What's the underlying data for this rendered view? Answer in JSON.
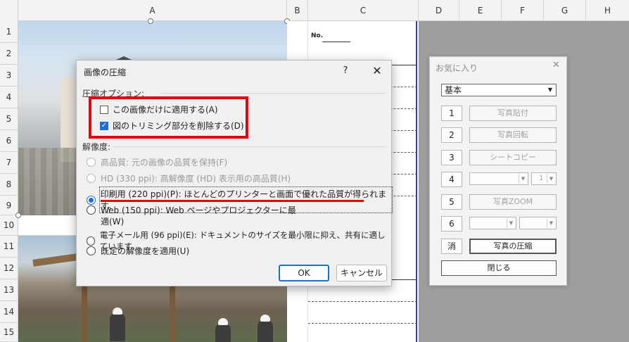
{
  "sheet": {
    "columns": [
      "A",
      "B",
      "C",
      "D",
      "E",
      "F",
      "G",
      "H"
    ],
    "rows": [
      "1",
      "2",
      "3",
      "4",
      "5",
      "6",
      "7",
      "8",
      "9",
      "10",
      "11",
      "12",
      "13",
      "14",
      "15"
    ],
    "form_no_label": "No."
  },
  "dialog": {
    "title": "画像の圧縮",
    "help": "?",
    "close": "✕",
    "compression_group": "圧縮オプション:",
    "apply_only_this": {
      "label": "この画像だけに適用する(A)",
      "checked": false
    },
    "delete_cropped": {
      "label": "図のトリミング部分を削除する(D)",
      "checked": true
    },
    "resolution_group": "解像度:",
    "options": [
      {
        "label": "高品質: 元の画像の品質を保持(F)",
        "enabled": false,
        "selected": false
      },
      {
        "label": "HD (330 ppi): 高解像度 (HD) 表示用の高品質(H)",
        "enabled": false,
        "selected": false
      },
      {
        "label": "印刷用 (220 ppi)(P): ほとんどのプリンターと画面で優れた品質が得られます。",
        "enabled": true,
        "selected": true
      },
      {
        "label": "Web (150 ppi): Web ページやプロジェクターに最",
        "label_cont": "適(W)",
        "enabled": true,
        "selected": false
      },
      {
        "label": "電子メール用 (96 ppi)(E): ドキュメントのサイズを最小限に抑え、共有に適しています。",
        "enabled": true,
        "selected": false
      },
      {
        "label": "既定の解像度を適用(U)",
        "enabled": true,
        "selected": false
      }
    ],
    "ok": "OK",
    "cancel": "キャンセル"
  },
  "favorites": {
    "title": "お気に入り",
    "close": "✕",
    "preset": "基本",
    "rows": [
      {
        "num": "1",
        "label": "写真貼付"
      },
      {
        "num": "2",
        "label": "写真回転"
      },
      {
        "num": "3",
        "label": "シートコピー"
      },
      {
        "num": "4",
        "label": "",
        "combo_value": "1"
      },
      {
        "num": "5",
        "label": "写真ZOOM"
      },
      {
        "num": "6",
        "label": ""
      }
    ],
    "clear": "消",
    "compress": "写真の圧縮",
    "close_button": "閉じる"
  },
  "colors": {
    "highlight_red": "#e0000f",
    "accent_blue": "#1f6fd1",
    "sheet_border_blue": "#2f3ea8"
  }
}
